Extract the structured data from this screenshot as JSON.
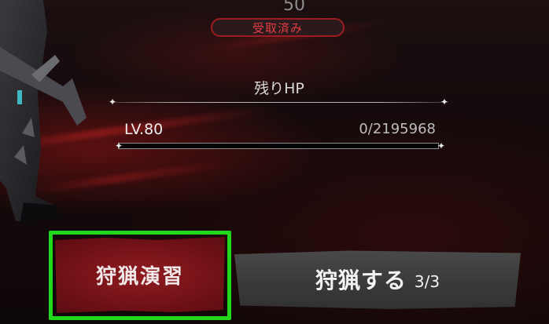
{
  "reward": {
    "count": "50",
    "status": "受取済み"
  },
  "boss": {
    "hp_title": "残りHP",
    "level": "LV.80",
    "hp_text": "0/2195968",
    "hp_fraction": 0
  },
  "actions": {
    "practice_label": "狩猟演習",
    "hunt_label": "狩猟する",
    "hunt_count": "3/3"
  },
  "colors": {
    "highlight": "#22d81c",
    "practice_button": "#7a1419",
    "hunt_button": "#3f3f3f",
    "badge_text": "#e23b44"
  }
}
